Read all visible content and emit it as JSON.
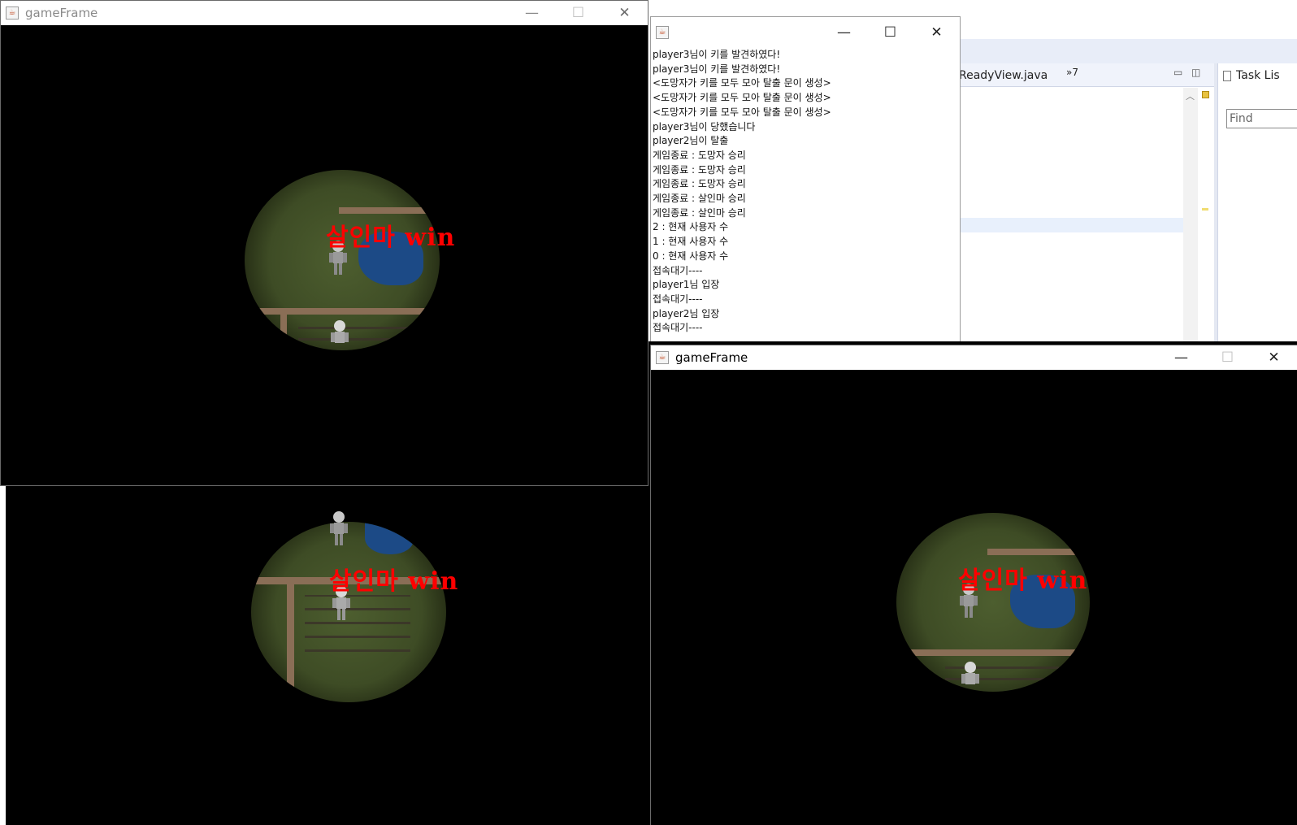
{
  "colors": {
    "win_text": "#ff0000",
    "canvas_bg": "#000000",
    "grass": "#4a5a2c",
    "water": "#1c4a86",
    "path": "#8a6e56"
  },
  "ide": {
    "editor_tab_label": "ReadyView.java",
    "overflow_label": "»7",
    "task_list_label": "Task Lis",
    "find_placeholder": "Find"
  },
  "log_window": {
    "title": "",
    "lines": [
      "player3님이 키를 발견하였다!",
      "player3님이 키를 발견하였다!",
      "<도망자가 키를 모두 모아 탈출 문이 생성>",
      "<도망자가 키를 모두 모아 탈출 문이 생성>",
      "<도망자가 키를 모두 모아 탈출 문이 생성>",
      "player3님이 당했습니다",
      "player2님이 탈출",
      "게임종료 : 도망자 승리",
      "게임종료 : 도망자 승리",
      "게임종료 : 도망자 승리",
      "게임종료 : 살인마 승리",
      "게임종료 : 살인마 승리",
      "2 : 현재 사용자 수",
      "1 : 현재 사용자 수",
      "0 : 현재 사용자 수",
      "접속대기----",
      "player1님 입장",
      "접속대기----",
      "player2님 입장",
      "접속대기----"
    ]
  },
  "game_windows": [
    {
      "title": "gameFrame",
      "overlay_text": "살인마 win"
    },
    {
      "title": "",
      "overlay_text": "살인마 win"
    },
    {
      "title": "gameFrame",
      "overlay_text": "살인마 win"
    }
  ],
  "window_controls": {
    "minimize": "—",
    "maximize": "☐",
    "close": "✕"
  }
}
